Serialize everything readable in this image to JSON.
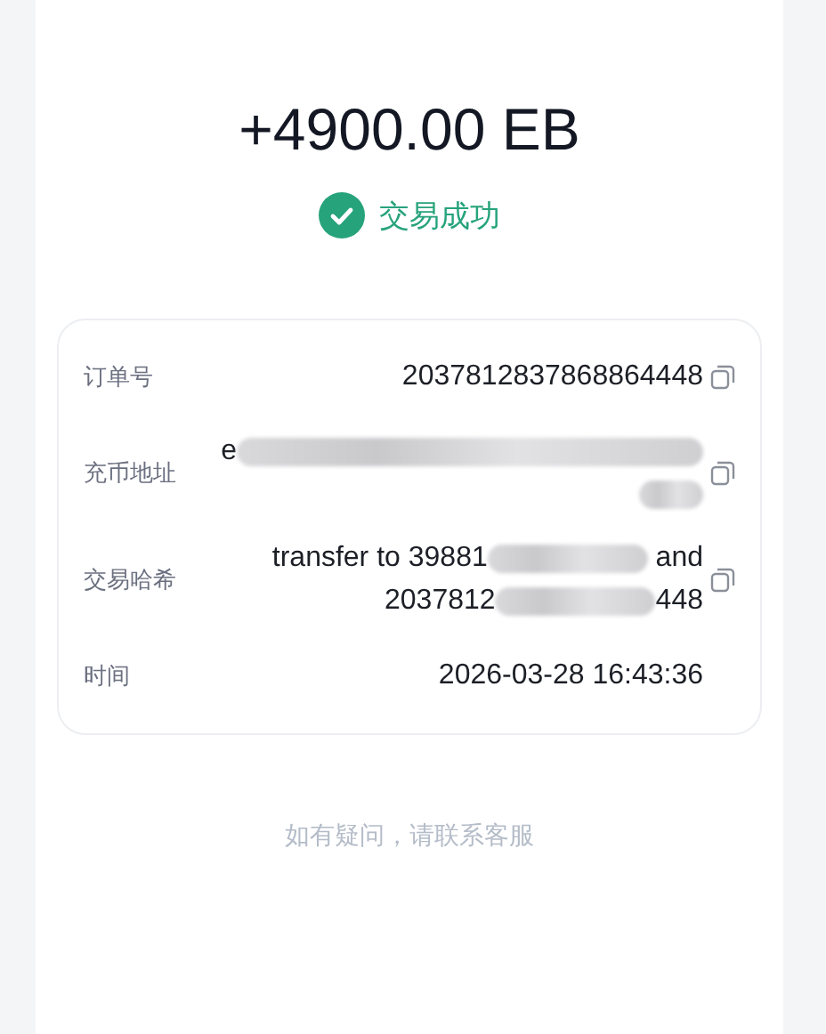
{
  "amount": "+4900.00 EB",
  "status": {
    "label": "交易成功",
    "kind": "success"
  },
  "details": [
    {
      "label": "订单号",
      "kind": "text",
      "value": "2037812837868864448",
      "copyable": true
    },
    {
      "label": "充币地址",
      "kind": "parts",
      "lines": [
        [
          {
            "kind": "text",
            "text": "e"
          },
          {
            "kind": "redacted"
          }
        ],
        [
          {
            "kind": "redacted"
          }
        ]
      ],
      "copyable": true
    },
    {
      "label": "交易哈希",
      "kind": "parts",
      "lines": [
        [
          {
            "kind": "text",
            "text": "transfer to 39881"
          },
          {
            "kind": "redacted"
          },
          {
            "kind": "text",
            "text": " and"
          }
        ],
        [
          {
            "kind": "text",
            "text": "2037812"
          },
          {
            "kind": "redacted"
          },
          {
            "kind": "text",
            "text": "448"
          }
        ]
      ],
      "copyable": true
    },
    {
      "label": "时间",
      "kind": "text",
      "value": "2026-03-28 16:43:36",
      "copyable": false
    }
  ],
  "help_text": "如有疑问，请联系客服"
}
